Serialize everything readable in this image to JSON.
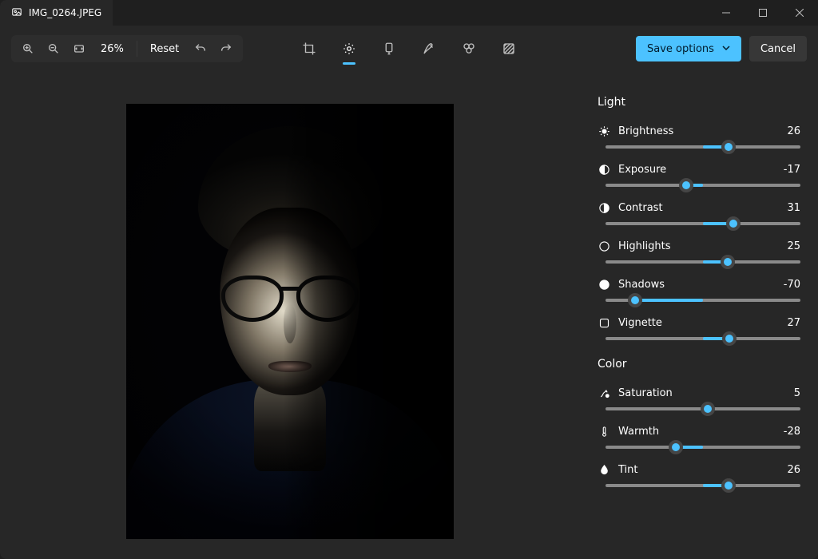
{
  "titlebar": {
    "filename": "IMG_0264.JPEG"
  },
  "toolbar": {
    "zoom_percent": "26%",
    "reset_label": "Reset",
    "save_label": "Save options",
    "cancel_label": "Cancel"
  },
  "panel": {
    "sections": {
      "light_title": "Light",
      "color_title": "Color"
    },
    "sliders": [
      {
        "key": "brightness",
        "label": "Brightness",
        "value": 26,
        "min": -100,
        "max": 100,
        "icon": "brightness"
      },
      {
        "key": "exposure",
        "label": "Exposure",
        "value": -17,
        "min": -100,
        "max": 100,
        "icon": "exposure"
      },
      {
        "key": "contrast",
        "label": "Contrast",
        "value": 31,
        "min": -100,
        "max": 100,
        "icon": "contrast"
      },
      {
        "key": "highlights",
        "label": "Highlights",
        "value": 25,
        "min": -100,
        "max": 100,
        "icon": "highlights"
      },
      {
        "key": "shadows",
        "label": "Shadows",
        "value": -70,
        "min": -100,
        "max": 100,
        "icon": "shadows"
      },
      {
        "key": "vignette",
        "label": "Vignette",
        "value": 27,
        "min": -100,
        "max": 100,
        "icon": "vignette"
      }
    ],
    "color_sliders": [
      {
        "key": "saturation",
        "label": "Saturation",
        "value": 5,
        "min": -100,
        "max": 100,
        "icon": "saturation"
      },
      {
        "key": "warmth",
        "label": "Warmth",
        "value": -28,
        "min": -100,
        "max": 100,
        "icon": "warmth"
      },
      {
        "key": "tint",
        "label": "Tint",
        "value": 26,
        "min": -100,
        "max": 100,
        "icon": "tint"
      }
    ]
  }
}
